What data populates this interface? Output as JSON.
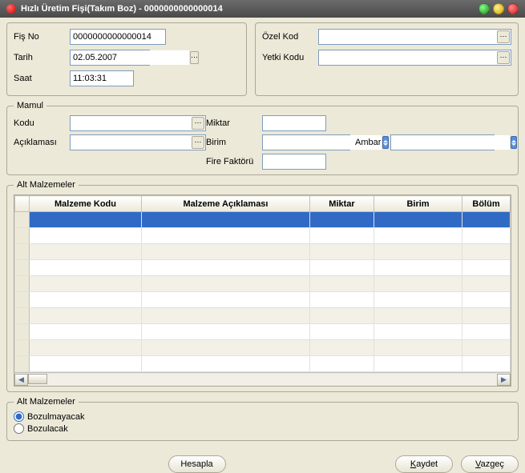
{
  "window": {
    "title": "Hızlı Üretim Fişi(Takım Boz) - 0000000000000014"
  },
  "form": {
    "fis_no_label": "Fiş No",
    "fis_no_value": "0000000000000014",
    "tarih_label": "Tarih",
    "tarih_value": "02.05.2007",
    "saat_label": "Saat",
    "saat_value": "11:03:31",
    "ozel_kod_label": "Özel Kod",
    "ozel_kod_value": "",
    "yetki_kodu_label": "Yetki Kodu",
    "yetki_kodu_value": ""
  },
  "mamul": {
    "legend": "Mamul",
    "kodu_label": "Kodu",
    "kodu_value": "",
    "aciklamasi_label": "Açıklaması",
    "aciklamasi_value": "",
    "miktar_label": "Miktar",
    "miktar_value": "",
    "birim_label": "Birim",
    "birim_value": "",
    "ambar_label": "Ambar",
    "ambar_value": "",
    "fire_label": "Fire Faktörü",
    "fire_value": ""
  },
  "grid": {
    "legend": "Alt Malzemeler",
    "cols": {
      "malzeme_kodu": "Malzeme Kodu",
      "malzeme_aciklamasi": "Malzeme Açıklaması",
      "miktar": "Miktar",
      "birim": "Birim",
      "bolum": "Bölüm"
    }
  },
  "alt_options": {
    "legend": "Alt Malzemeler",
    "bozulmayacak": "Bozulmayacak",
    "bozulacak": "Bozulacak",
    "selected": "bozulmayacak"
  },
  "buttons": {
    "hesapla": "Hesapla",
    "kaydet": "Kaydet",
    "vazgec": "Vazgeç"
  }
}
